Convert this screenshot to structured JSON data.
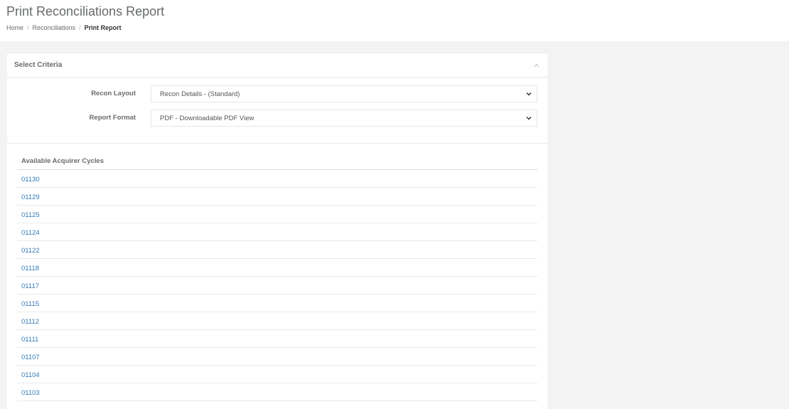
{
  "page": {
    "title": "Print Reconciliations Report",
    "breadcrumb": {
      "home": "Home",
      "separator": "/",
      "section": "Reconciliations",
      "current": "Print Report"
    }
  },
  "criteria": {
    "title": "Select Criteria",
    "recon_layout": {
      "label": "Recon Layout",
      "value": "Recon Details - (Standard)"
    },
    "report_format": {
      "label": "Report Format",
      "value": "PDF - Downloadable PDF View"
    }
  },
  "cycles": {
    "header": "Available Acquirer Cycles",
    "items": [
      "01130",
      "01129",
      "01125",
      "01124",
      "01122",
      "01118",
      "01117",
      "01115",
      "01112",
      "01111",
      "01107",
      "01104",
      "01103"
    ]
  },
  "colors": {
    "link": "#337ab7",
    "text": "#676a6c",
    "background": "#f3f3f4"
  },
  "icons": {
    "collapse": "chevron-up-icon",
    "select_caret": "chevron-down-icon"
  }
}
